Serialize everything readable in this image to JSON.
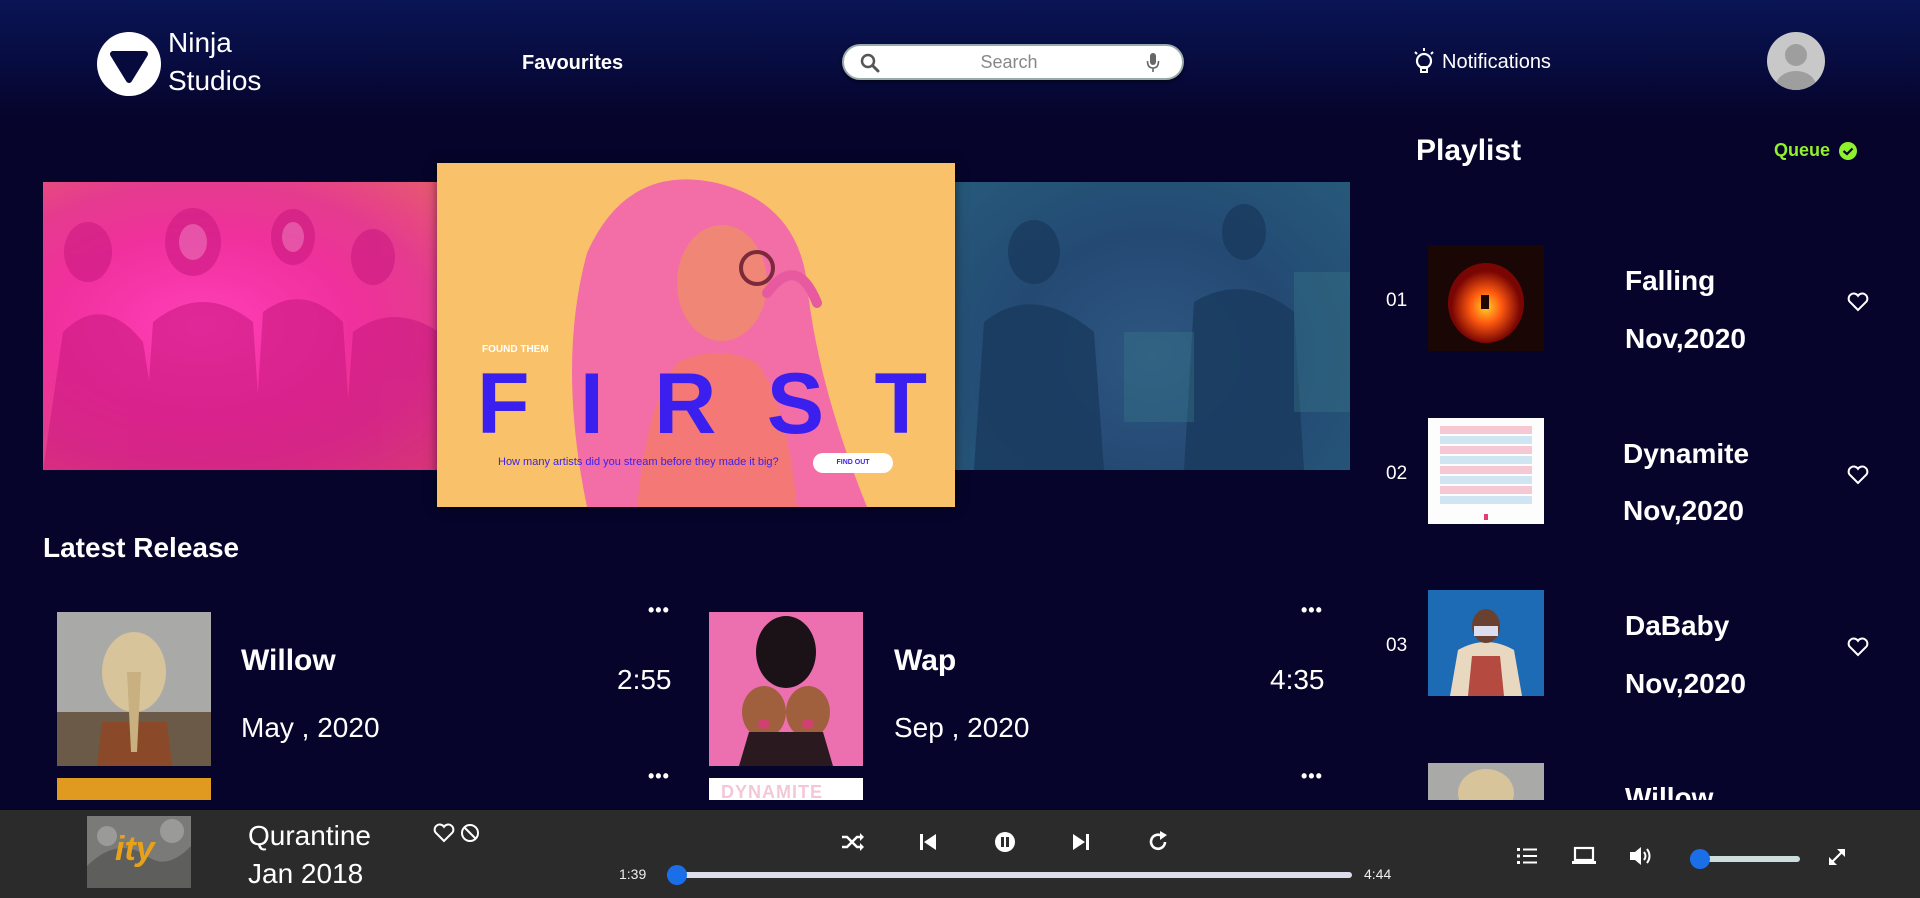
{
  "header": {
    "brand_line1": "Ninja",
    "brand_line2": "Studios",
    "nav_favourites": "Favourites",
    "search_placeholder": "Search",
    "notifications": "Notifications"
  },
  "carousel": {
    "kicker": "FOUND THEM",
    "headline_letters": [
      "F",
      "I",
      "R",
      "S",
      "T"
    ],
    "question": "How many artists did you stream before they made it big?",
    "cta": "FIND OUT"
  },
  "latest": {
    "title": "Latest Release",
    "items": [
      {
        "title": "Willow",
        "date": "May , 2020",
        "duration": "2:55",
        "more": "•••"
      },
      {
        "title": "Wap",
        "date": "Sep , 2020",
        "duration": "4:35",
        "more": "•••"
      }
    ],
    "more_row2": [
      "•••",
      "•••"
    ],
    "dynamite_art": "DYNAMITE"
  },
  "playlist": {
    "title": "Playlist",
    "queue_label": "Queue",
    "items": [
      {
        "num": "01",
        "name": "Falling",
        "date": "Nov,2020"
      },
      {
        "num": "02",
        "name": "Dynamite",
        "date": "Nov,2020"
      },
      {
        "num": "03",
        "name": "DaBaby",
        "date": "Nov,2020"
      },
      {
        "num": "",
        "name": "Willow",
        "date": ""
      }
    ]
  },
  "player": {
    "title": "Qurantine",
    "date": "Jan 2018",
    "elapsed": "1:39",
    "total": "4:44",
    "progress_percent": 0,
    "volume_percent": 0,
    "cover_text": "ity"
  },
  "colors": {
    "background": "#06042a",
    "queue_accent": "#8ff02e",
    "slider_thumb": "#1a6fe8",
    "headline": "#3a1fef"
  },
  "icons": [
    "logo-play-icon",
    "search-icon",
    "mic-icon",
    "lightbulb-icon",
    "avatar-icon",
    "check-circle-icon",
    "heart-icon",
    "more-icon",
    "block-icon",
    "shuffle-icon",
    "previous-icon",
    "pause-icon",
    "next-icon",
    "repeat-icon",
    "queue-list-icon",
    "device-icon",
    "volume-icon",
    "fullscreen-icon"
  ]
}
